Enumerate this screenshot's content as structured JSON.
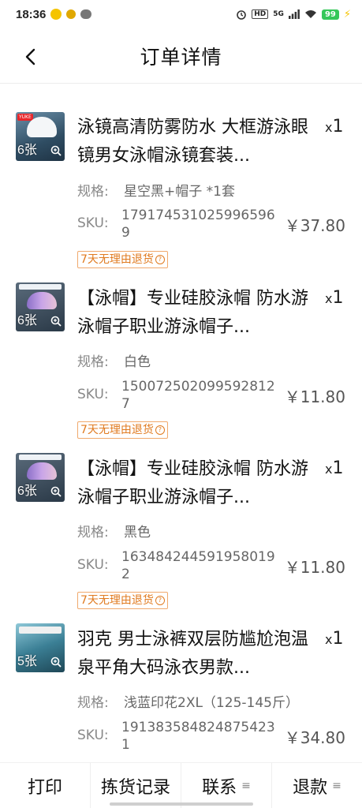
{
  "status": {
    "time": "18:36",
    "battery": "99",
    "network": "5G"
  },
  "header": {
    "title": "订单详情"
  },
  "items": [
    {
      "title": "泳镜高清防雾防水 大框游泳眼镜男女泳帽泳镜套装...",
      "qty_x": "x",
      "qty": "1",
      "image_count": "6张",
      "spec_label": "规格:",
      "spec": "星空黑+帽子 *1套",
      "sku_label": "SKU:",
      "sku": "1791745310259965969",
      "price": "￥37.80",
      "badge": "7天无理由退货"
    },
    {
      "title": "【泳帽】专业硅胶泳帽 防水游泳帽子职业游泳帽子...",
      "qty_x": "x",
      "qty": "1",
      "image_count": "6张",
      "spec_label": "规格:",
      "spec": "白色",
      "sku_label": "SKU:",
      "sku": "1500725020995928127",
      "price": "￥11.80",
      "badge": "7天无理由退货"
    },
    {
      "title": "【泳帽】专业硅胶泳帽 防水游泳帽子职业游泳帽子...",
      "qty_x": "x",
      "qty": "1",
      "image_count": "6张",
      "spec_label": "规格:",
      "spec": "黑色",
      "sku_label": "SKU:",
      "sku": "1634842445919580192",
      "price": "￥11.80",
      "badge": "7天无理由退货"
    },
    {
      "title": "羽克 男士泳裤双层防尴尬泡温泉平角大码泳衣男款...",
      "qty_x": "x",
      "qty": "1",
      "image_count": "5张",
      "spec_label": "规格:",
      "spec": "浅蓝印花2XL（125-145斤）",
      "sku_label": "SKU:",
      "sku": "1913835848248754231",
      "price": "￥34.80",
      "badge": ""
    }
  ],
  "bottom_bar": {
    "print": "打印",
    "picking_record": "拣货记录",
    "contact": "联系",
    "refund": "退款"
  },
  "colors": {
    "badge": "#e07a1f",
    "accent": "#111111"
  }
}
